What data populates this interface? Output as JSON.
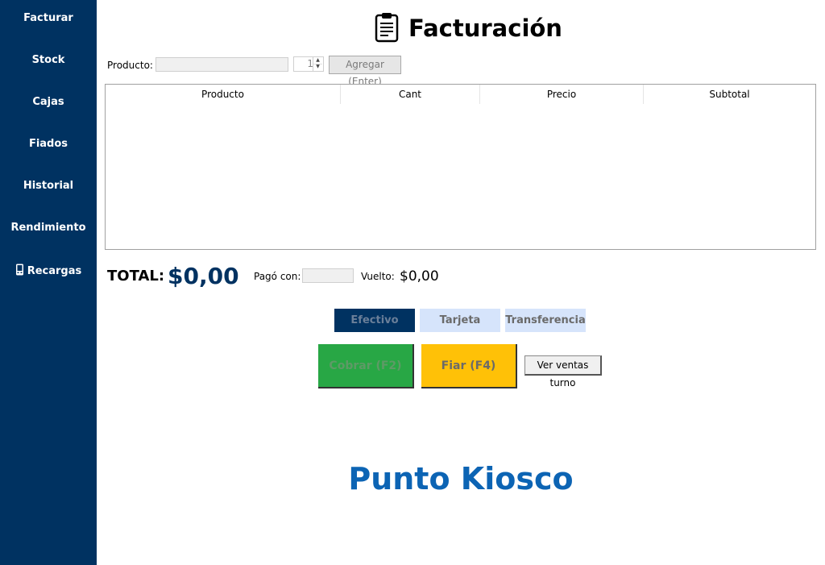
{
  "sidebar": {
    "items": [
      {
        "label": "Facturar"
      },
      {
        "label": "Stock"
      },
      {
        "label": "Cajas"
      },
      {
        "label": "Fiados"
      },
      {
        "label": "Historial"
      },
      {
        "label": "Rendimiento"
      },
      {
        "label": "Recargas",
        "icon": "phone-icon"
      }
    ]
  },
  "header": {
    "title": "Facturación",
    "icon": "clipboard-icon"
  },
  "entry": {
    "product_label": "Producto:",
    "product_value": "",
    "quantity": "1",
    "add_button": "Agregar (Enter)"
  },
  "table": {
    "columns": [
      "Producto",
      "Cant",
      "Precio",
      "Subtotal"
    ],
    "rows": []
  },
  "summary": {
    "total_label": "TOTAL:",
    "total_value": "$0,00",
    "paid_label": "Pagó con:",
    "paid_value": "",
    "change_label": "Vuelto:",
    "change_value": "$0,00"
  },
  "payment_methods": [
    {
      "label": "Efectivo",
      "selected": true
    },
    {
      "label": "Tarjeta",
      "selected": false
    },
    {
      "label": "Transferencia",
      "selected": false
    }
  ],
  "actions": {
    "charge": "Cobrar (F2)",
    "credit": "Fiar (F4)",
    "view_shift": "Ver ventas turno"
  },
  "brand": "Punto Kiosco",
  "colors": {
    "sidebar_bg": "#003261",
    "selected_method": "#003261",
    "unselected_method": "#d6e4fb",
    "charge_bg": "#28a745",
    "credit_bg": "#ffc107",
    "brand_text": "#0c64b4"
  }
}
